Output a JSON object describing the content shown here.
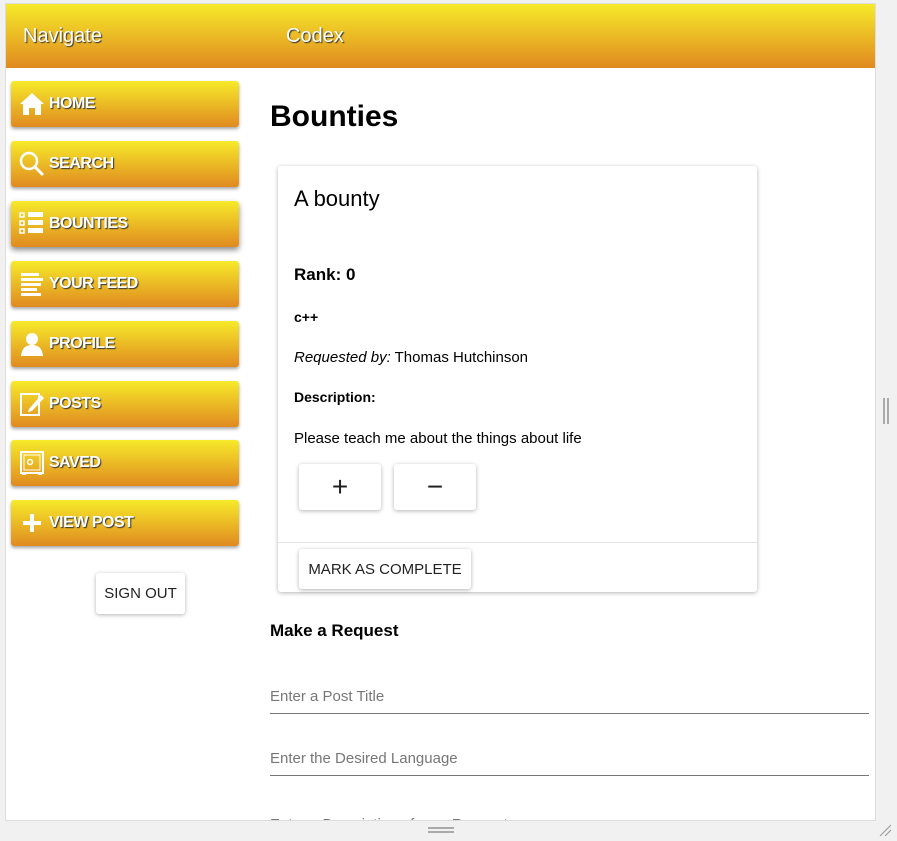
{
  "header": {
    "navigate": "Navigate",
    "app_title": "Codex"
  },
  "sidebar": {
    "items": [
      {
        "label": "HOME",
        "icon": "home-icon"
      },
      {
        "label": "SEARCH",
        "icon": "search-icon"
      },
      {
        "label": "BOUNTIES",
        "icon": "checklist-icon"
      },
      {
        "label": "YOUR FEED",
        "icon": "feed-icon"
      },
      {
        "label": "PROFILE",
        "icon": "user-icon"
      },
      {
        "label": "POSTS",
        "icon": "edit-icon"
      },
      {
        "label": "SAVED",
        "icon": "safe-icon"
      },
      {
        "label": "VIEW POST",
        "icon": "plus-icon"
      }
    ],
    "sign_out": "SIGN OUT"
  },
  "main": {
    "title": "Bounties",
    "bounty": {
      "title": "A bounty",
      "rank": "Rank: 0",
      "language": "c++",
      "requested_by_label": "Requested by:",
      "requested_by": " Thomas Hutchinson",
      "description_label": "Description:",
      "description": "Please teach me about the things about life",
      "upvote": "+",
      "downvote": "−",
      "mark_complete": "MARK AS COMPLETE"
    },
    "request": {
      "heading": "Make a Request",
      "title_placeholder": "Enter a Post Title",
      "language_placeholder": "Enter the Desired Language",
      "description_placeholder": "Enter a Description of your Request"
    }
  }
}
